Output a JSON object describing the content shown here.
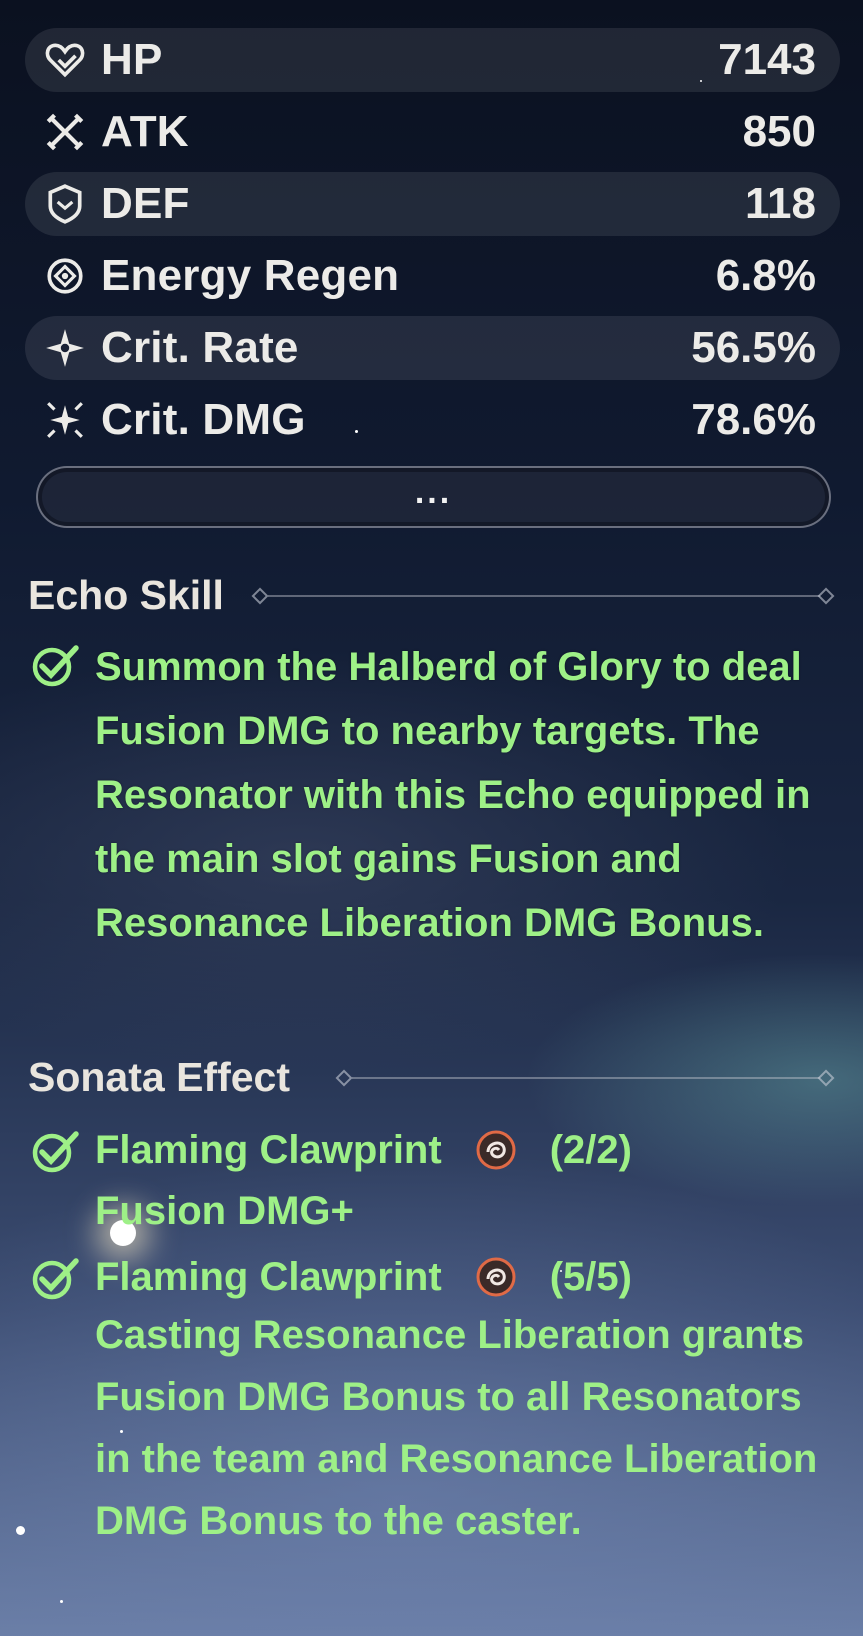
{
  "stats": [
    {
      "icon": "heart-icon",
      "label": "HP",
      "value": "7143"
    },
    {
      "icon": "swords-icon",
      "label": "ATK",
      "value": "850"
    },
    {
      "icon": "shield-icon",
      "label": "DEF",
      "value": "118"
    },
    {
      "icon": "energy-regen-icon",
      "label": "Energy Regen",
      "value": "6.8%"
    },
    {
      "icon": "crit-rate-icon",
      "label": "Crit. Rate",
      "value": "56.5%"
    },
    {
      "icon": "crit-dmg-icon",
      "label": "Crit. DMG",
      "value": "78.6%"
    }
  ],
  "more_button": {
    "label": "..."
  },
  "echo_skill": {
    "title": "Echo Skill",
    "description": "Summon the Halberd of Glory to deal Fusion DMG to nearby targets. The Resonator with this Echo equipped in the main slot gains Fusion and Resonance Liberation DMG Bonus."
  },
  "sonata_effect": {
    "title": "Sonata Effect",
    "items": [
      {
        "set_name": "Flaming Clawprint",
        "icon": "fusion-set-icon",
        "pieces": "(2/2)",
        "description": "Fusion DMG+"
      },
      {
        "set_name": "Flaming Clawprint",
        "icon": "fusion-set-icon",
        "pieces": "(5/5)",
        "description": "Casting Resonance Liberation grants Fusion DMG Bonus to all Resonators in the team and Resonance Liberation DMG Bonus to the caster."
      }
    ]
  },
  "colors": {
    "effect_text": "#9ef087",
    "stat_text": "#ecebe8",
    "fusion_icon": "#e06a46"
  }
}
